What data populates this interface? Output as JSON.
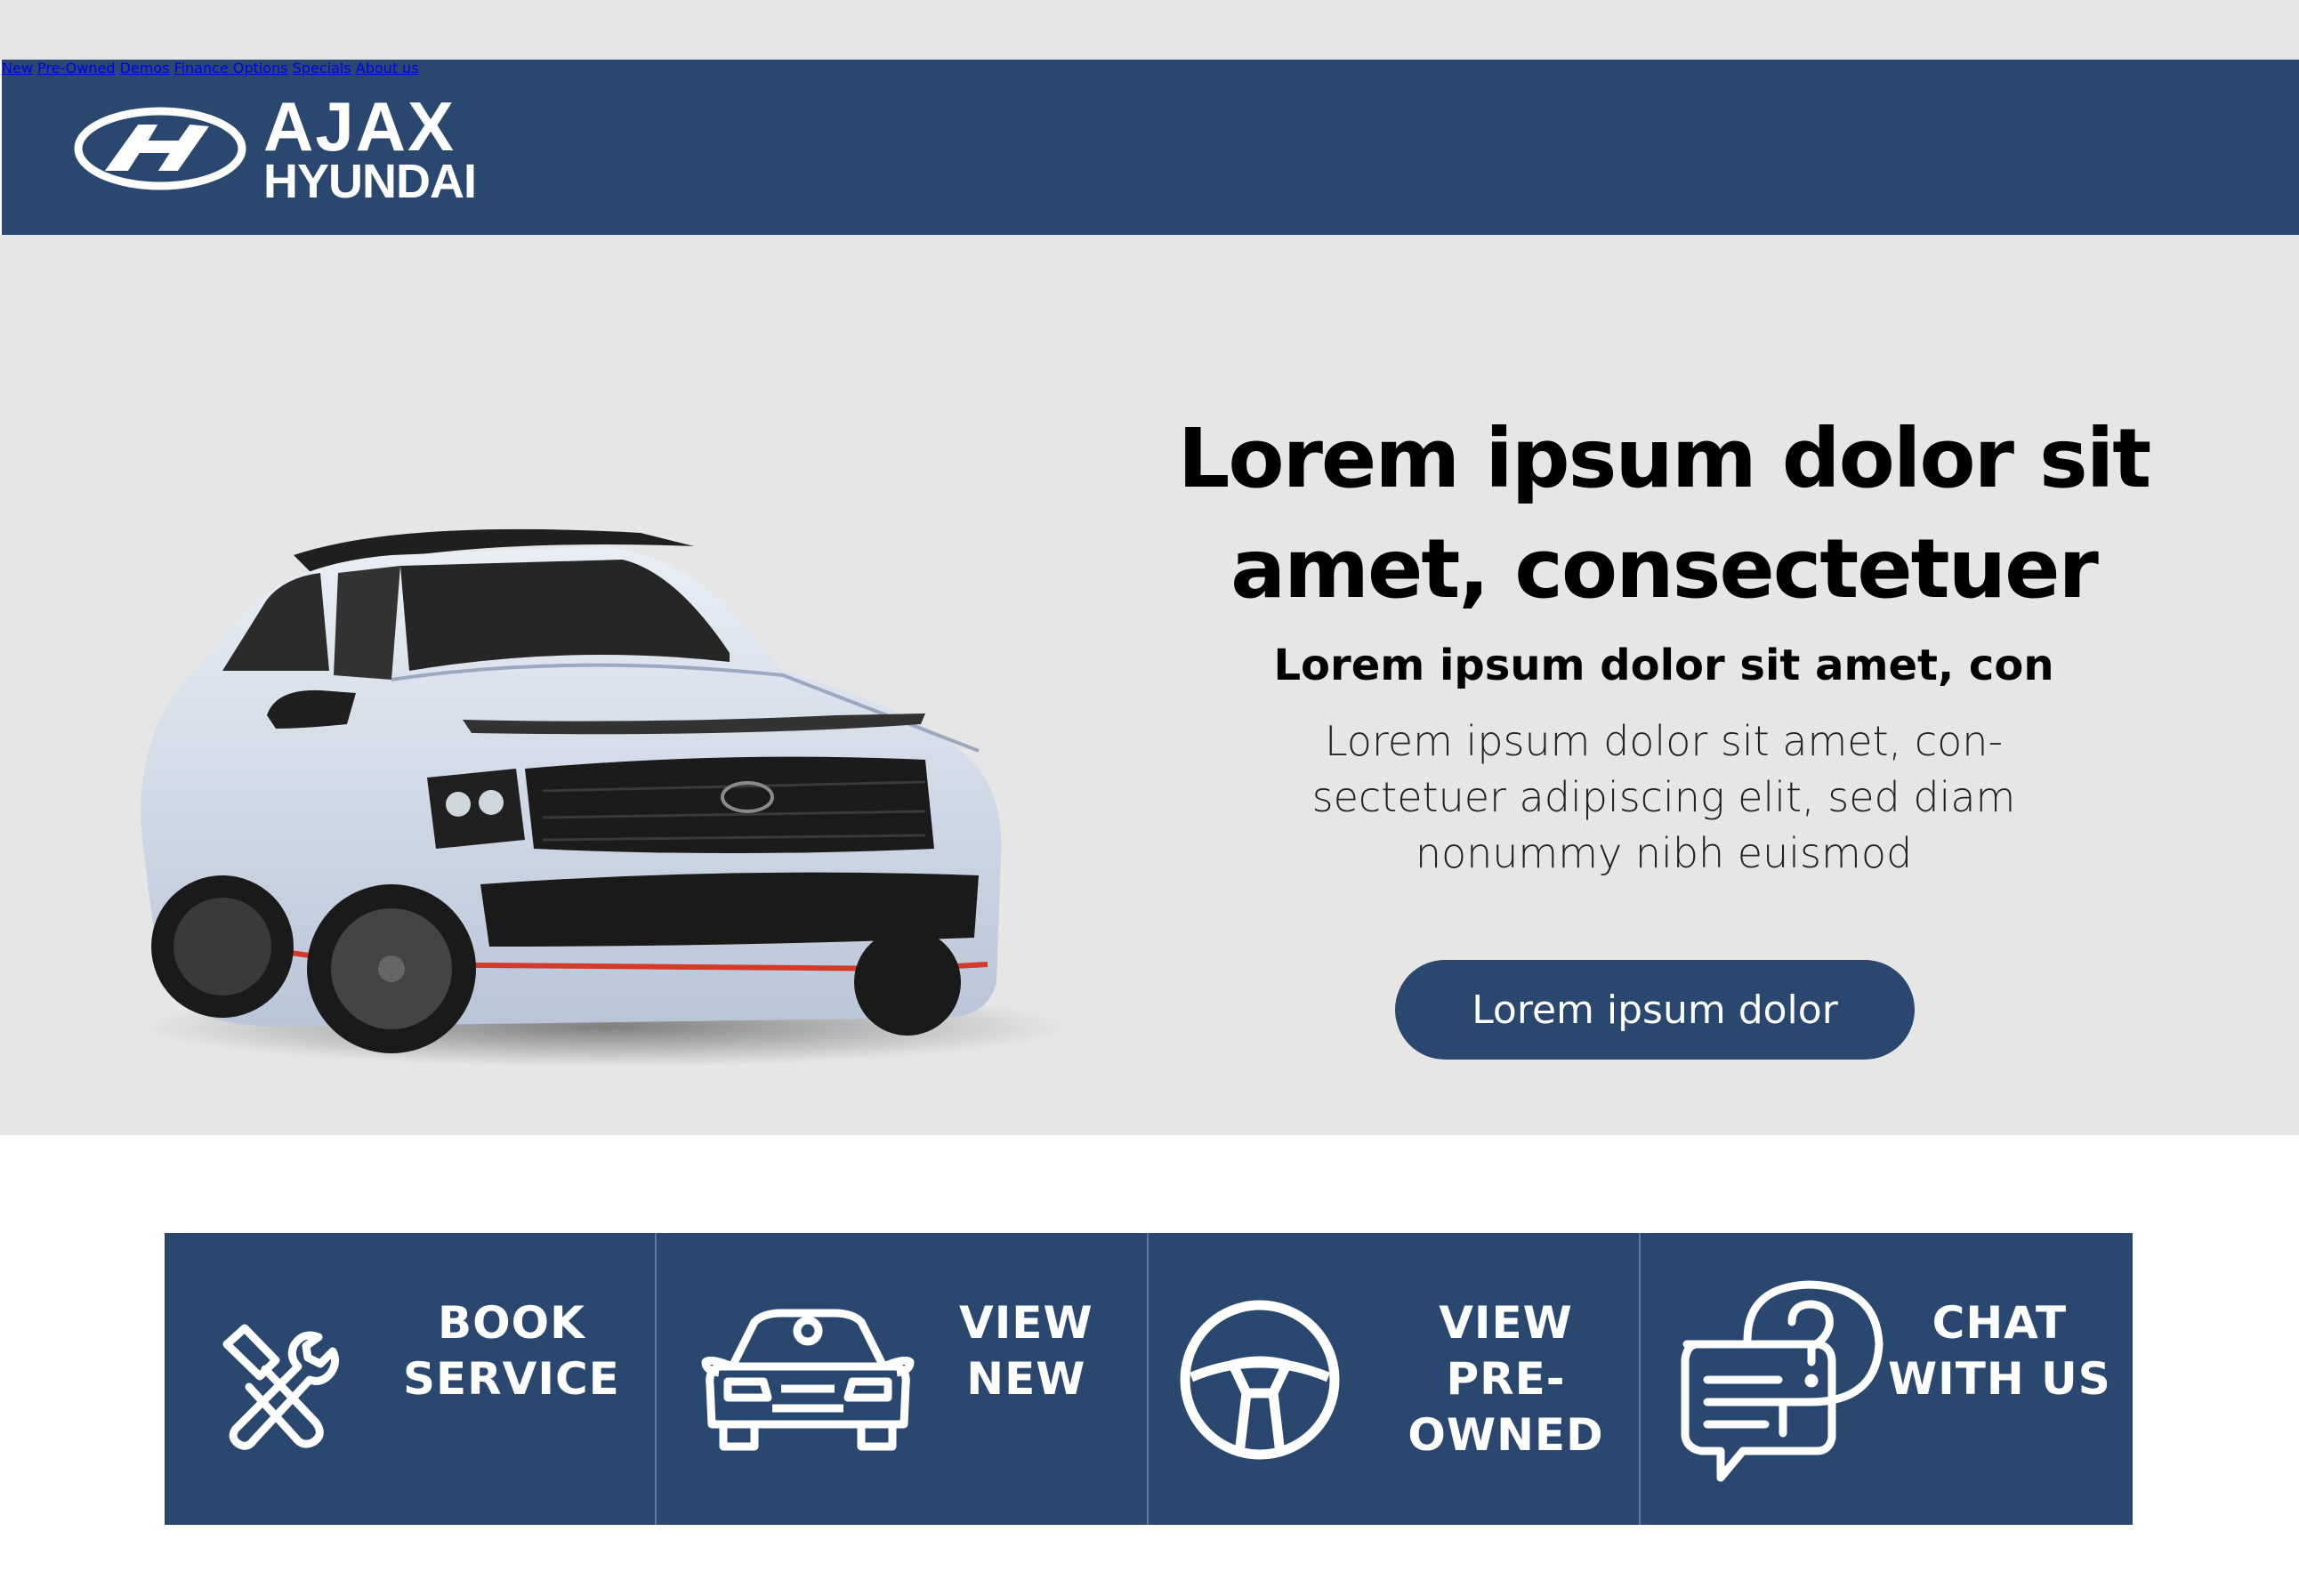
{
  "brand": {
    "line1": "AJAX",
    "line2": "HYUNDAI"
  },
  "nav": {
    "items": [
      {
        "label": "New"
      },
      {
        "label": "Pre-Owned"
      },
      {
        "label": "Demos"
      },
      {
        "label": "Finance Options"
      },
      {
        "label": "Specials"
      },
      {
        "label": "About us"
      }
    ]
  },
  "hero": {
    "title": "Lorem ipsum dolor sit amet, consectetuer",
    "subtitle": "Lorem ipsum dolor sit amet, con",
    "body": "Lorem ipsum dolor sit amet, con-sectetuer adipiscing elit, sed diam nonummy nibh euismod",
    "cta": "Lorem ipsum dolor"
  },
  "tiles": [
    {
      "label": "BOOK\nSERVICE",
      "icon": "tools-icon"
    },
    {
      "label": "VIEW\nNEW",
      "icon": "car-front-icon"
    },
    {
      "label": "VIEW\nPRE-OWNED",
      "icon": "steering-wheel-icon"
    },
    {
      "label": "CHAT\nWITH US",
      "icon": "chat-question-icon"
    }
  ],
  "colors": {
    "primary": "#2a4770",
    "hero_bg": "#e6e6e6",
    "car_body": "#d6dfec",
    "car_accent": "#d43a2a"
  }
}
